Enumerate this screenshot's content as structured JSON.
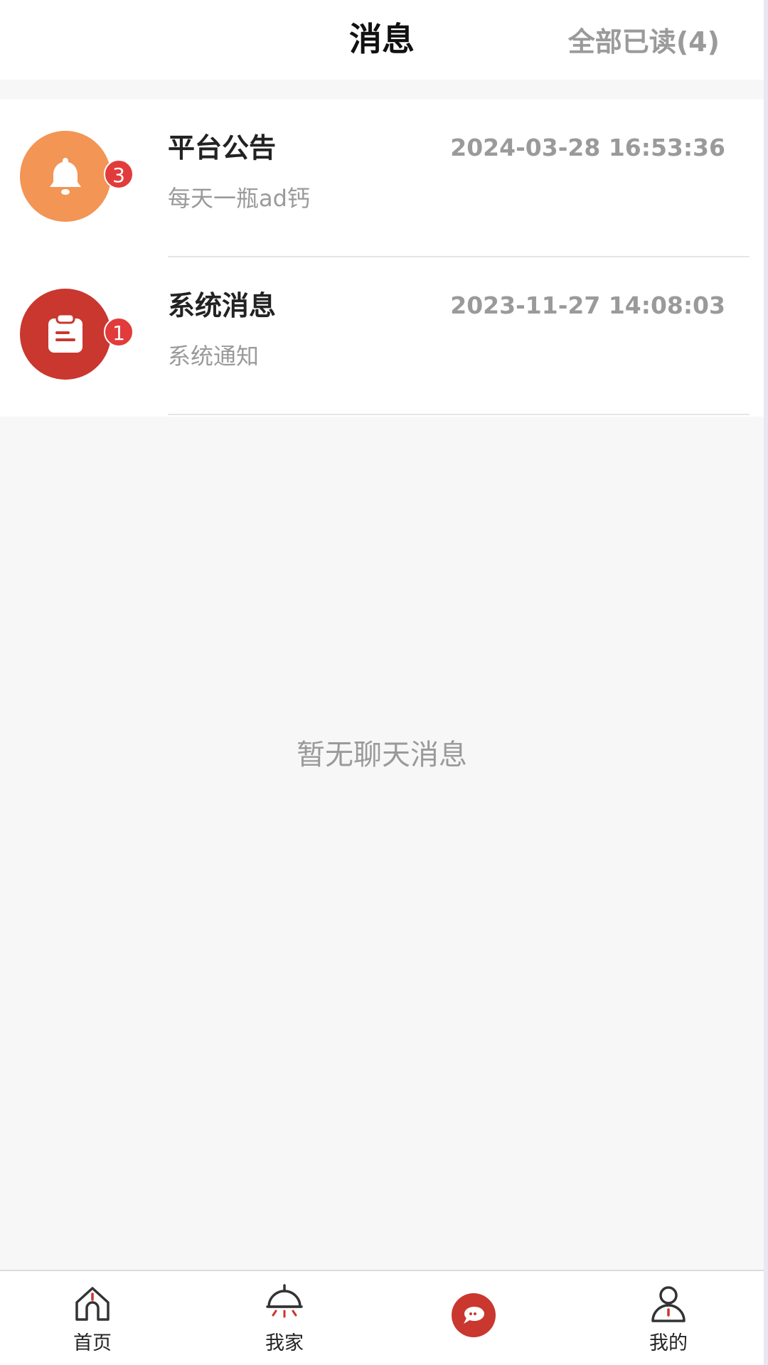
{
  "header": {
    "title": "消息",
    "mark_all_read_label": "全部已读",
    "mark_all_read_count": "(4)"
  },
  "messages": [
    {
      "title": "平台公告",
      "subtitle": "每天一瓶ad钙",
      "time": "2024-03-28 16:53:36",
      "badge": "3",
      "icon": "bell-icon",
      "icon_bg": "#f29555"
    },
    {
      "title": "系统消息",
      "subtitle": "系统通知",
      "time": "2023-11-27 14:08:03",
      "badge": "1",
      "icon": "clipboard-icon",
      "icon_bg": "#c9372f"
    }
  ],
  "empty_state": {
    "text": "暂无聊天消息"
  },
  "tabbar": {
    "items": [
      {
        "label": "首页",
        "icon": "home-icon"
      },
      {
        "label": "我家",
        "icon": "lamp-icon"
      },
      {
        "label": "",
        "icon": "chat-bubble-icon",
        "active": true
      },
      {
        "label": "我的",
        "icon": "user-icon"
      }
    ]
  },
  "colors": {
    "accent": "#c9372f",
    "badge": "#e23b3b",
    "orange": "#f29555",
    "muted_text": "#9a9a9a",
    "background": "#f7f7f7"
  }
}
